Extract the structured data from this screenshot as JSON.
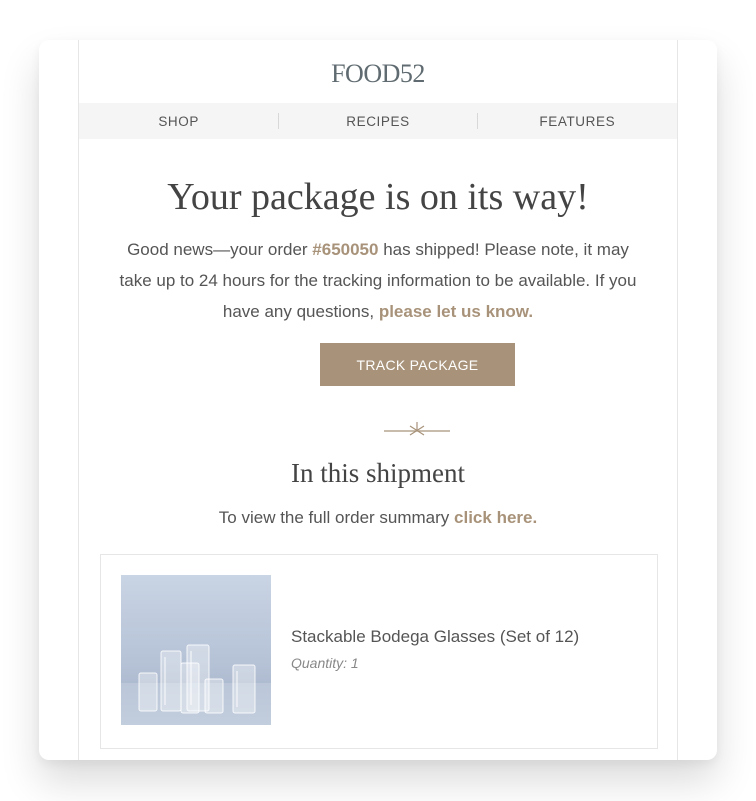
{
  "brand": {
    "logo_text": "FOOD52",
    "accent_color": "#a8937a",
    "text_color": "#555555"
  },
  "nav": {
    "items": [
      {
        "label": "SHOP"
      },
      {
        "label": "RECIPES"
      },
      {
        "label": "FEATURES"
      }
    ]
  },
  "main": {
    "headline": "Your package is on its way!",
    "intro_prefix": "Good news—your order ",
    "order_number": "#650050",
    "intro_middle": " has shipped! Please note, it may take up to 24 hours for the tracking information to be available. If you have any questions, ",
    "contact_link": "please let us know.",
    "track_button": "TRACK PACKAGE",
    "divider_icon": "sparkle-line-divider-icon"
  },
  "shipment": {
    "title": "In this shipment",
    "summary_prefix": "To view the full order summary ",
    "summary_link": "click here.",
    "items": [
      {
        "name": "Stackable Bodega Glasses (Set of 12)",
        "quantity_label": "Quantity: 1",
        "image_icon": "glasses-photo"
      }
    ]
  }
}
